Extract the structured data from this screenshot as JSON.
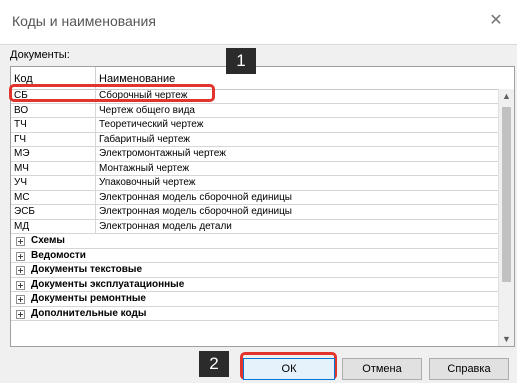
{
  "window": {
    "title": "Коды и наименования",
    "close_glyph": "✕"
  },
  "section_label": "Документы:",
  "columns": {
    "code": "Код",
    "name": "Наименование"
  },
  "rows": [
    {
      "code": "СБ",
      "name": "Сборочный чертеж"
    },
    {
      "code": "ВО",
      "name": "Чертеж общего вида"
    },
    {
      "code": "ТЧ",
      "name": "Теоретический чертеж"
    },
    {
      "code": "ГЧ",
      "name": "Габаритный чертеж"
    },
    {
      "code": "МЭ",
      "name": "Электромонтажный чертеж"
    },
    {
      "code": "МЧ",
      "name": "Монтажный чертеж"
    },
    {
      "code": "УЧ",
      "name": "Упаковочный чертеж"
    },
    {
      "code": "МС",
      "name": "Электронная модель сборочной единицы"
    },
    {
      "code": "ЭСБ",
      "name": "Электронная модель сборочной единицы"
    },
    {
      "code": "МД",
      "name": "Электронная модель детали"
    }
  ],
  "groups": [
    "Схемы",
    "Ведомости",
    "Документы текстовые",
    "Документы эксплуатационные",
    "Документы ремонтные",
    "Дополнительные коды"
  ],
  "scrollbar": {
    "up_glyph": "▲",
    "down_glyph": "▼"
  },
  "badges": {
    "first": "1",
    "second": "2"
  },
  "buttons": {
    "ok": "ОК",
    "cancel": "Отмена",
    "help": "Справка"
  },
  "colors": {
    "highlight": "#e0342c",
    "badge": "#2b2b2b",
    "ok_border": "#0078d7"
  }
}
